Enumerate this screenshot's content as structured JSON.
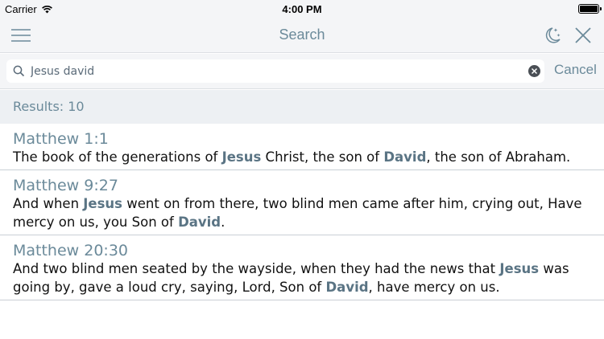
{
  "status_bar": {
    "carrier": "Carrier",
    "time": "4:00 PM",
    "battery_level": 1.0
  },
  "nav": {
    "title": "Search",
    "menu_icon": "hamburger-menu-icon",
    "night_icon": "moon-stars-icon",
    "close_icon": "close-icon"
  },
  "search": {
    "query": "Jesus david",
    "placeholder": "Search",
    "cancel_label": "Cancel"
  },
  "results": {
    "count_label": "Results: 10",
    "highlight_color": "#5a7484",
    "items": [
      {
        "reference": "Matthew 1:1",
        "segments": [
          {
            "text": "The book of the generations of ",
            "hl": false
          },
          {
            "text": "Jesus",
            "hl": true
          },
          {
            "text": " Christ, the son of ",
            "hl": false
          },
          {
            "text": "David",
            "hl": true
          },
          {
            "text": ", the son of Abraham.",
            "hl": false
          }
        ]
      },
      {
        "reference": "Matthew 9:27",
        "segments": [
          {
            "text": "And when ",
            "hl": false
          },
          {
            "text": "Jesus",
            "hl": true
          },
          {
            "text": " went on from there, two blind men came after him, crying out, Have mercy on us, you Son of ",
            "hl": false
          },
          {
            "text": "David",
            "hl": true
          },
          {
            "text": ".",
            "hl": false
          }
        ]
      },
      {
        "reference": "Matthew 20:30",
        "segments": [
          {
            "text": "And two blind men seated by the wayside, when they had the news that ",
            "hl": false
          },
          {
            "text": "Jesus",
            "hl": true
          },
          {
            "text": " was going by, gave a loud cry, saying, Lord, Son of ",
            "hl": false
          },
          {
            "text": "David",
            "hl": true
          },
          {
            "text": ", have mercy on us.",
            "hl": false
          }
        ]
      }
    ]
  }
}
